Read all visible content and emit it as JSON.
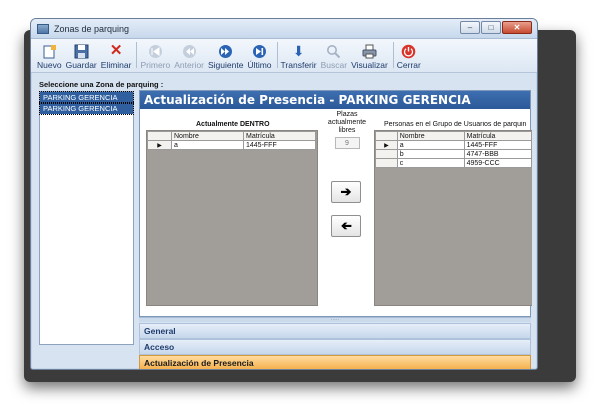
{
  "window": {
    "title": "Zonas de parquing"
  },
  "toolbar": {
    "nuevo": "Nuevo",
    "guardar": "Guardar",
    "eliminar": "Eliminar",
    "primero": "Primero",
    "anterior": "Anterior",
    "siguiente": "Siguiente",
    "ultimo": "Último",
    "transferir": "Transferir",
    "buscar": "Buscar",
    "visualizar": "Visualizar",
    "cerrar": "Cerrar"
  },
  "zone_select": {
    "label": "Seleccione una Zona de parquing :",
    "items": [
      "PARKING GERENCIA",
      "PARKING GERENCIA"
    ]
  },
  "panel": {
    "title": "Actualización de Presencia - PARKING GERENCIA",
    "inside": {
      "title": "Actualmente DENTRO",
      "columns": [
        "Nombre",
        "Matrícula"
      ],
      "rows": [
        {
          "nombre": "a",
          "matricula": "1445-FFF"
        }
      ]
    },
    "free_spots": {
      "label": "Plazas actualmente libres",
      "value": "9"
    },
    "group": {
      "title": "Personas en el Grupo de Usuarios de parquin",
      "columns": [
        "Nombre",
        "Matrícula"
      ],
      "rows": [
        {
          "nombre": "a",
          "matricula": "1445-FFF"
        },
        {
          "nombre": "b",
          "matricula": "4747-BBB"
        },
        {
          "nombre": "c",
          "matricula": "4959-CCC"
        }
      ]
    }
  },
  "sections": {
    "general": "General",
    "acceso": "Acceso",
    "presencia": "Actualización de Presencia"
  },
  "colors": {
    "header_blue": "#2b5898",
    "active_section": "#f4ae48"
  }
}
